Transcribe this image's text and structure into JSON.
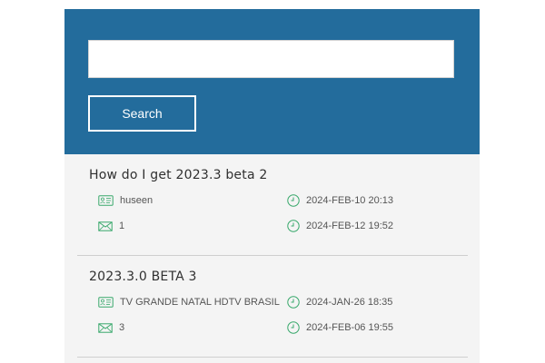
{
  "search": {
    "value": "",
    "placeholder": "",
    "button_label": "Search"
  },
  "results": [
    {
      "title": "How do I get 2023.3 beta 2",
      "author": "huseen",
      "replies": "1",
      "created": "2024-FEB-10 20:13",
      "updated": "2024-FEB-12 19:52"
    },
    {
      "title": "2023.3.0 BETA 3",
      "author": "TV GRANDE NATAL HDTV BRASIL",
      "replies": "3",
      "created": "2024-JAN-26 18:35",
      "updated": "2024-FEB-06 19:55"
    }
  ],
  "colors": {
    "header_blue": "#236c9c",
    "icon_green": "#38a86b",
    "result_background": "#f4f4f4"
  },
  "icons": {
    "author": "user-card-icon",
    "replies": "mail-icon",
    "time": "clock-icon"
  }
}
